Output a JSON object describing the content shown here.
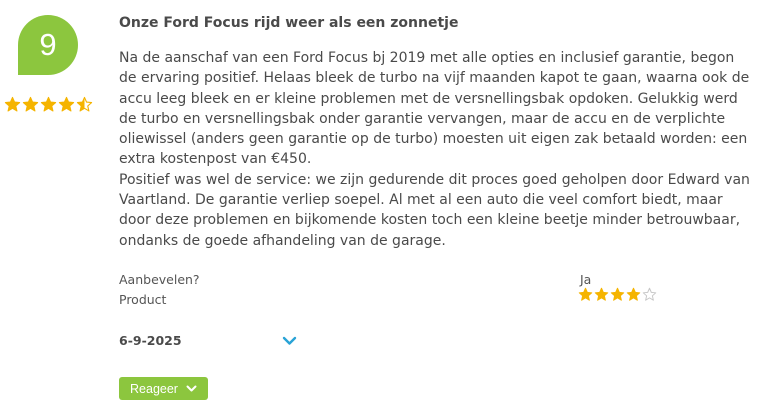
{
  "review": {
    "score": "9",
    "score_stars": 4.5,
    "title": "Onze Ford Focus rijd weer als een zonnetje",
    "paragraphs": [
      "Na de aanschaf van een Ford Focus bj 2019 met alle opties en inclusief garantie, begon de ervaring positief. Helaas bleek de turbo na vijf maanden kapot te gaan, waarna ook de accu leeg bleek en er kleine problemen met de versnellingsbak opdoken. Gelukkig werd de turbo en versnellingsbak onder garantie vervangen, maar de accu en de verplichte oliewissel (anders geen garantie op de turbo) moesten uit eigen zak betaald worden: een extra kostenpost van €450.",
      "Positief was wel de service: we zijn gedurende dit proces goed geholpen door Edward van Vaartland. De garantie verliep soepel. Al met al een auto die veel comfort biedt, maar door deze problemen en bijkomende kosten toch een kleine beetje minder betrouwbaar, ondanks de goede afhandeling van de garage."
    ],
    "recommend_label": "Aanbevelen?",
    "recommend_value": "Ja",
    "product_label": "Product",
    "product_stars": 4,
    "product_stars_max": 5,
    "date": "6-9-2025",
    "reply_label": "Reageer"
  },
  "colors": {
    "accent_green": "#8cc63e",
    "star_gold": "#f5b400",
    "star_empty": "#c8c8c8",
    "toggle_blue": "#29a3d6"
  },
  "icons": {
    "expand": "chevron-down-icon",
    "reply_dropdown": "chevron-down-icon",
    "star": "star-icon"
  }
}
